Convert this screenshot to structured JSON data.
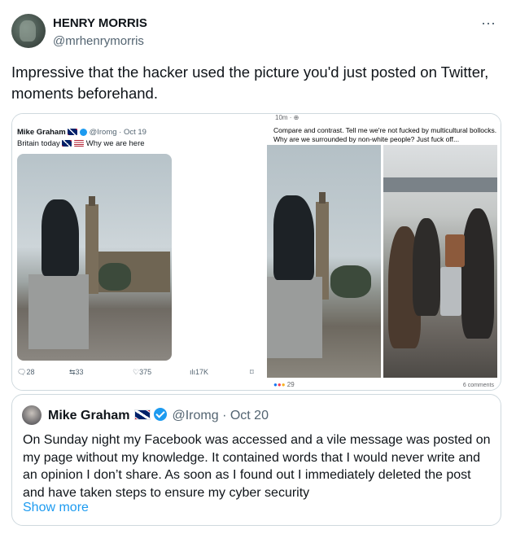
{
  "author": {
    "name": "HENRY MORRIS",
    "handle": "@mrhenrymorris",
    "more_icon": "⋯"
  },
  "tweet": {
    "text": "Impressive that the hacker used the picture you'd just posted on Twitter, moments beforehand."
  },
  "media_left": {
    "author_name": "Mike Graham",
    "handle": "@Iromg · Oct 19",
    "text": "Britain today",
    "text_suffix": "Why we are here",
    "actions": {
      "replies": "28",
      "retweets": "33",
      "likes": "375",
      "views": "17K"
    },
    "icons": [
      "reply-icon",
      "retweet-icon",
      "like-icon",
      "views-icon",
      "bookmark-icon"
    ]
  },
  "media_right": {
    "meta": "10m · ",
    "text": "Compare and contrast. Tell me we're not fucked by multicultural bollocks. Why are we surrounded by non-white people? Just fuck off...",
    "reactions": "29",
    "comments": "6 comments"
  },
  "quote": {
    "name": "Mike Graham",
    "handle": "@Iromg · Oct 20",
    "text": "On Sunday night my Facebook was accessed and a vile message was posted on my page without my knowledge. It contained words that I would never write and an opinion I don’t share. As soon as I found out I immediately deleted the post and have taken steps to ensure my cyber security",
    "show_more": "Show more"
  },
  "colors": {
    "text": "#0f1419",
    "secondary": "#536471",
    "link": "#1d9bf0",
    "border": "#cfd9de"
  }
}
